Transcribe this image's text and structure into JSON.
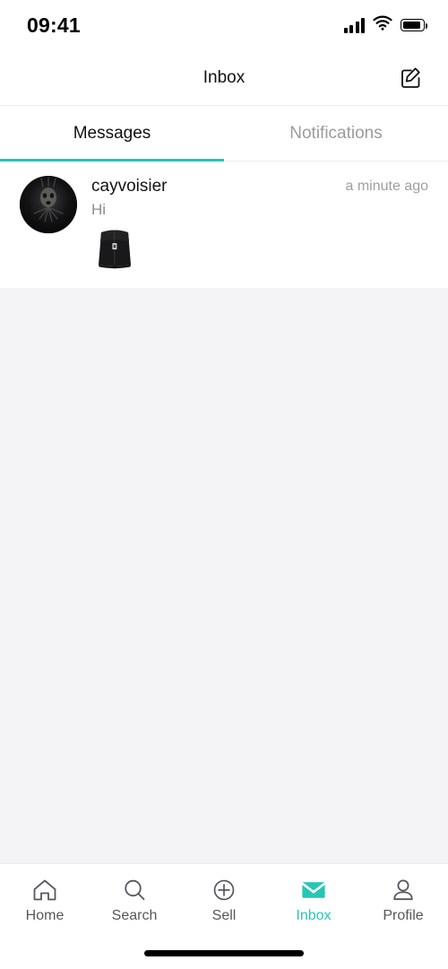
{
  "theme": {
    "accent": "#26c6b4",
    "text_primary": "#141414",
    "text_secondary": "#8d8d8d",
    "background": "#f4f4f6",
    "surface": "#ffffff"
  },
  "status_bar": {
    "time": "09:41",
    "cellular_icon": "cellular-signal-icon",
    "wifi_icon": "wifi-icon",
    "battery_icon": "battery-icon"
  },
  "header": {
    "title": "Inbox",
    "compose_icon": "compose-icon"
  },
  "tabs": {
    "items": [
      {
        "label": "Messages",
        "active": true
      },
      {
        "label": "Notifications",
        "active": false
      }
    ]
  },
  "messages": [
    {
      "username": "cayvoisier",
      "preview": "Hi",
      "timestamp": "a minute ago",
      "avatar_name": "avatar-cayvoisier",
      "attachment_name": "message-attachment-thumbnail"
    }
  ],
  "bottom_nav": {
    "items": [
      {
        "label": "Home",
        "icon": "home-icon",
        "active": false
      },
      {
        "label": "Search",
        "icon": "search-icon",
        "active": false
      },
      {
        "label": "Sell",
        "icon": "plus-circle-icon",
        "active": false
      },
      {
        "label": "Inbox",
        "icon": "envelope-icon",
        "active": true
      },
      {
        "label": "Profile",
        "icon": "person-icon",
        "active": false
      }
    ]
  },
  "home_indicator": "home-indicator"
}
